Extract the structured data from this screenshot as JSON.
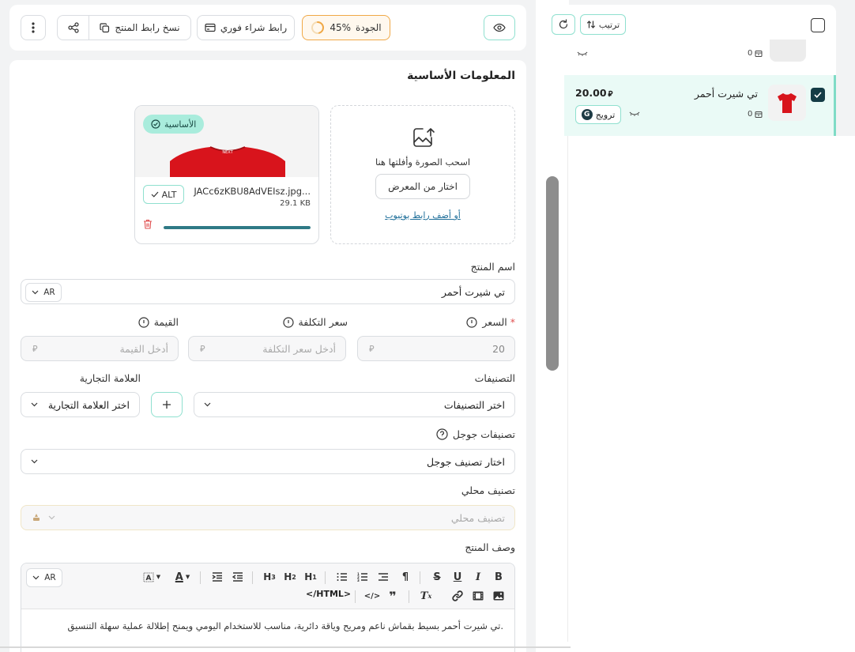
{
  "toolbar": {
    "copy_link_label": "نسخ رابط المنتج",
    "buy_link_label": "رابط شراء فوري",
    "quality_label": "الجودة",
    "quality_percent": "45%",
    "quality_value": 0.45
  },
  "section": {
    "title": "المعلومات الأساسية"
  },
  "uploader": {
    "drag_text": "اسحب الصورة وأفلتها هنا",
    "gallery_button": "اختار من المعرض",
    "youtube_link": "أو أضف رابط يوتيوب"
  },
  "image_card": {
    "badge": "الأساسية",
    "file_name": "JACc6zKBU8AdVEIsz.jpg...",
    "file_size": "29.1 KB",
    "alt_label": "ALT",
    "upload_progress": 1.0
  },
  "product_name": {
    "label": "اسم المنتج",
    "value": "تي شيرت أحمر",
    "lang": "AR"
  },
  "price": {
    "label": "السعر",
    "required_mark": "*",
    "value": "20"
  },
  "cost_price": {
    "label": "سعر التكلفة",
    "placeholder": "أدخل سعر التكلفة"
  },
  "worth": {
    "label": "القيمة",
    "placeholder": "أدخل القيمة"
  },
  "currency_symbol": "⃁",
  "categories": {
    "label": "التصنيفات",
    "placeholder": "اختر التصنيفات"
  },
  "brand": {
    "label": "العلامة التجارية",
    "placeholder": "اختر العلامة التجارية"
  },
  "google_categories": {
    "label": "تصنيفات جوجل",
    "placeholder": "اختار تصنيف جوجل"
  },
  "local_category": {
    "label": "تصنيف محلي",
    "placeholder": "تصنيف محلي"
  },
  "description": {
    "label": "وصف المنتج",
    "lang": "AR",
    "html_button": "</HTML>",
    "text": "تي شيرت أحمر بسيط بقماش ناعم ومريح وياقة دائرية، مناسب للاستخدام اليومي ويمنح إطلالة عملية سهلة التنسيق."
  },
  "list_panel": {
    "sort_label": "ترتيب",
    "prev_row_count": "0",
    "selected_row": {
      "name": "تي شيرت أحمر",
      "price": "20.00",
      "currency": "⃁",
      "count": "0",
      "promo_label": "ترويج",
      "promo_letter": "G"
    }
  },
  "colors": {
    "accent_teal": "#8fe0cf",
    "quality_orange": "#f0a846",
    "selected_row_bg": "#eafaf6",
    "progress": "#2f7a86",
    "checkbox_dark": "#143c46"
  }
}
